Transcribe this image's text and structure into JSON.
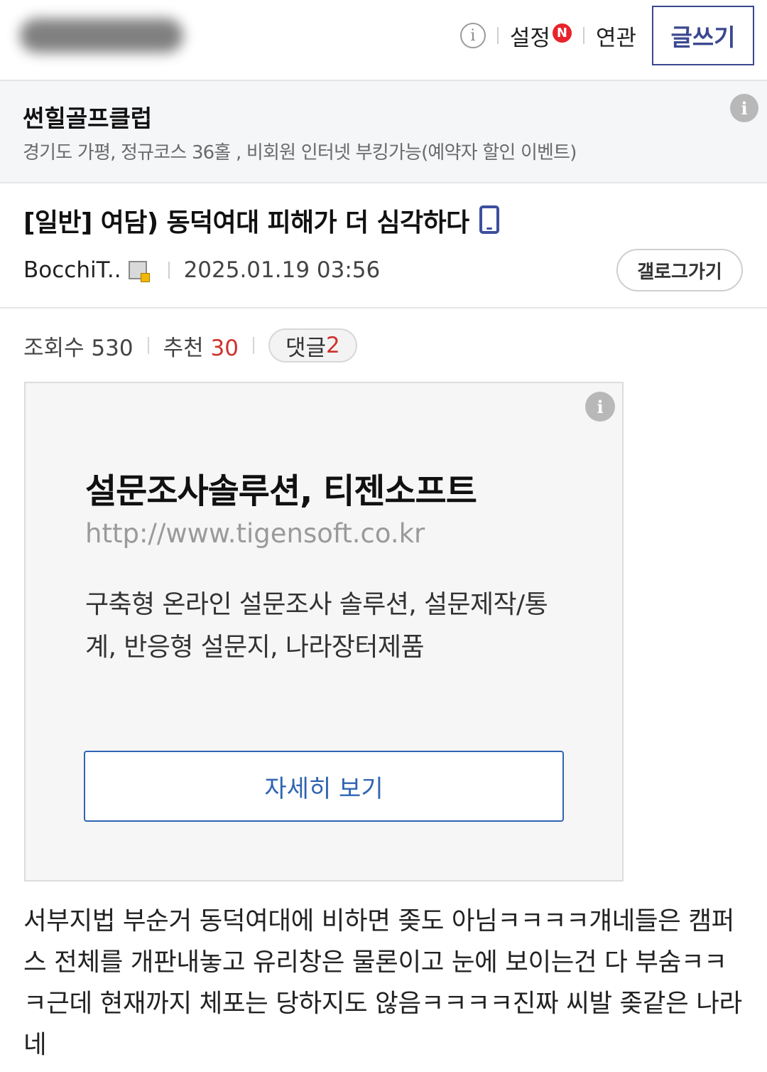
{
  "topbar": {
    "info_icon": "info-circle-outline-icon",
    "settings_label": "설정",
    "new_badge": "N",
    "related_label": "연관",
    "write_label": "글쓰기"
  },
  "gallery": {
    "name": "썬힐골프클럽",
    "description": "경기도 가평, 정규코스 36홀 , 비회원 인터넷 부킹가능(예약자 할인 이벤트)"
  },
  "post": {
    "title": "[일반] 여담) 동덕여대 피해가 더 심각하다",
    "author": "BocchiT..",
    "date": "2025.01.19 03:56",
    "gallery_button": "갤로그가기",
    "views_label": "조회수 530",
    "recommend_label": "추천",
    "recommend_count": "30",
    "comment_label": "댓글",
    "comment_count": "2",
    "body": "서부지법 부순거 동덕여대에 비하면 좆도 아님ㅋㅋㅋㅋ걔네들은 캠퍼스 전체를 개판내놓고 유리창은 물론이고 눈에 보이는건 다 부숨ㅋㅋㅋ근데 현재까지 체포는 당하지도 않음ㅋㅋㅋㅋ진짜 씨발 좆같은 나라네"
  },
  "ad": {
    "title": "설문조사솔루션, 티젠소프트",
    "url": "http://www.tigensoft.co.kr",
    "description": "구축형 온라인 설문조사 솔루션, 설문제작/통계, 반응형 설문지, 나라장터제품",
    "button": "자세히 보기"
  },
  "colors": {
    "accent_navy": "#3b4890",
    "recommend_red": "#d0312d",
    "ad_button_blue": "#2f64b3",
    "new_badge_red": "#e8232a"
  }
}
